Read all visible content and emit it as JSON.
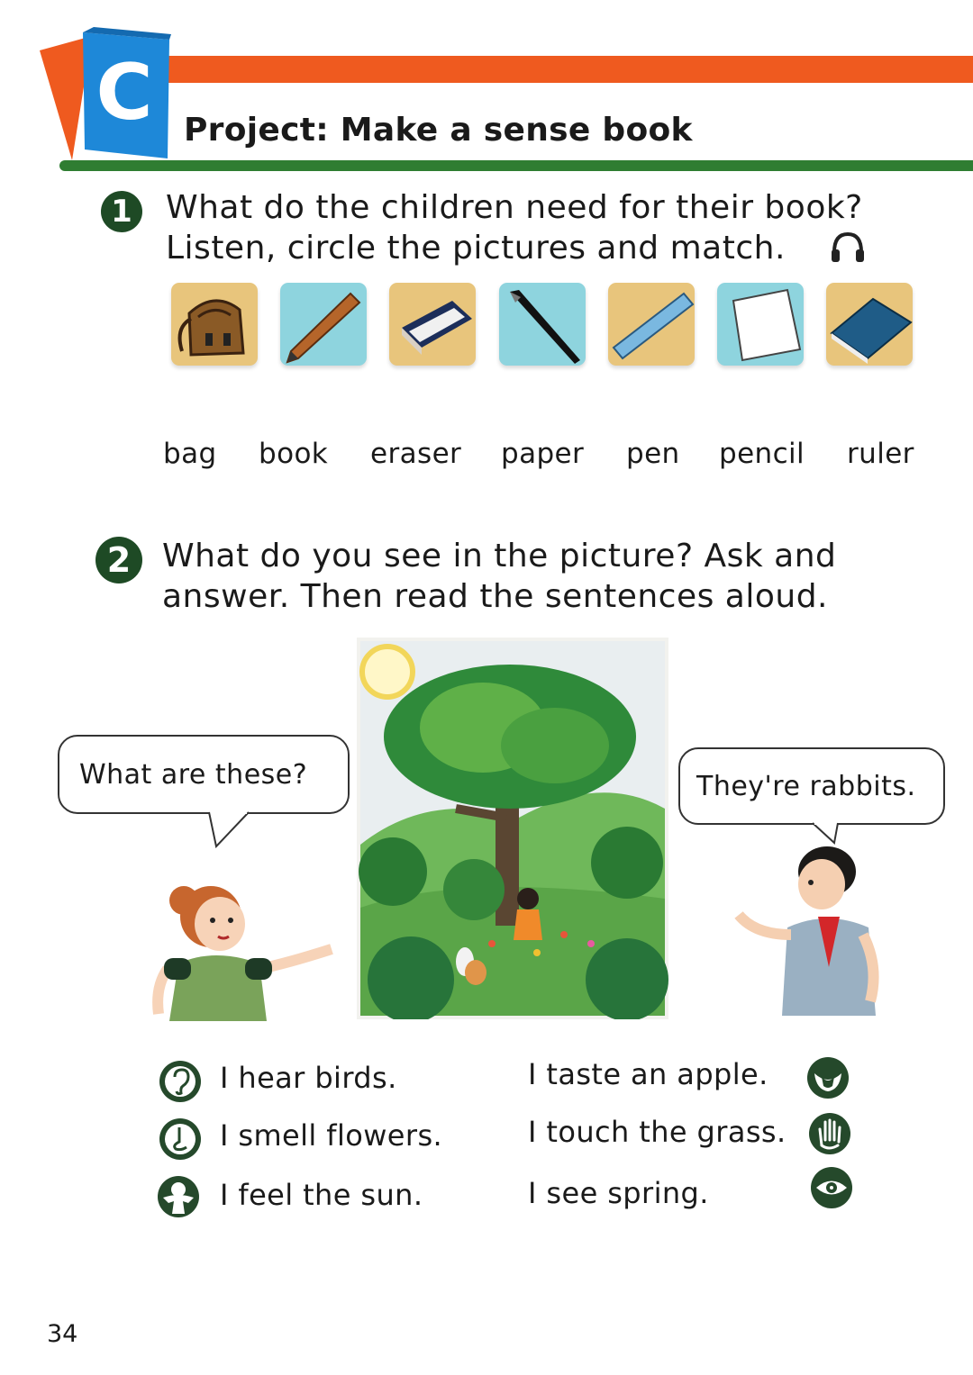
{
  "header": {
    "section_letter": "C",
    "title": "Project: Make a sense book"
  },
  "exercise1": {
    "number": "1",
    "instruction_line1": "What do the children need for their book?",
    "instruction_line2": "Listen, circle the pictures and match.",
    "audio_icon": "headphones-icon",
    "pictures": [
      "bag",
      "pencil",
      "eraser",
      "pen",
      "ruler",
      "paper",
      "book"
    ],
    "words": [
      "bag",
      "book",
      "eraser",
      "paper",
      "pen",
      "pencil",
      "ruler"
    ]
  },
  "exercise2": {
    "number": "2",
    "instruction_line1": "What do you see in the picture? Ask and",
    "instruction_line2": "answer. Then read the sentences aloud.",
    "bubble_left": "What are these?",
    "bubble_right": "They're rabbits.",
    "sentences": [
      {
        "text": "I hear birds.",
        "icon": "ear-icon"
      },
      {
        "text": "I smell flowers.",
        "icon": "nose-icon"
      },
      {
        "text": "I feel the sun.",
        "icon": "body-icon"
      },
      {
        "text": "I taste an apple.",
        "icon": "tongue-icon"
      },
      {
        "text": "I touch the grass.",
        "icon": "hand-icon"
      },
      {
        "text": "I see spring.",
        "icon": "eye-icon"
      }
    ]
  },
  "page_number": "34",
  "colors": {
    "orange": "#ef5a1f",
    "green": "#2f7d32",
    "badge": "#1e4a25",
    "tile_blue": "#1e88d8"
  }
}
